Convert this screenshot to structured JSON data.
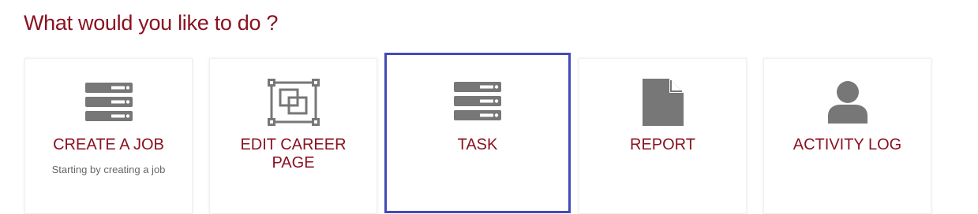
{
  "header": {
    "title": "What would you like to do ?"
  },
  "colors": {
    "accent": "#8b1220",
    "icon": "#777777",
    "selected_border": "#4449b8"
  },
  "cards": [
    {
      "title": "CREATE A JOB",
      "subtitle": "Starting by creating a job",
      "icon": "server-stack-icon",
      "selected": false
    },
    {
      "title": "EDIT CAREER PAGE",
      "subtitle": "",
      "icon": "layers-select-icon",
      "selected": false
    },
    {
      "title": "TASK",
      "subtitle": "",
      "icon": "server-stack-icon",
      "selected": true
    },
    {
      "title": "REPORT",
      "subtitle": "",
      "icon": "document-icon",
      "selected": false
    },
    {
      "title": "ACTIVITY LOG",
      "subtitle": "",
      "icon": "user-icon",
      "selected": false
    }
  ]
}
